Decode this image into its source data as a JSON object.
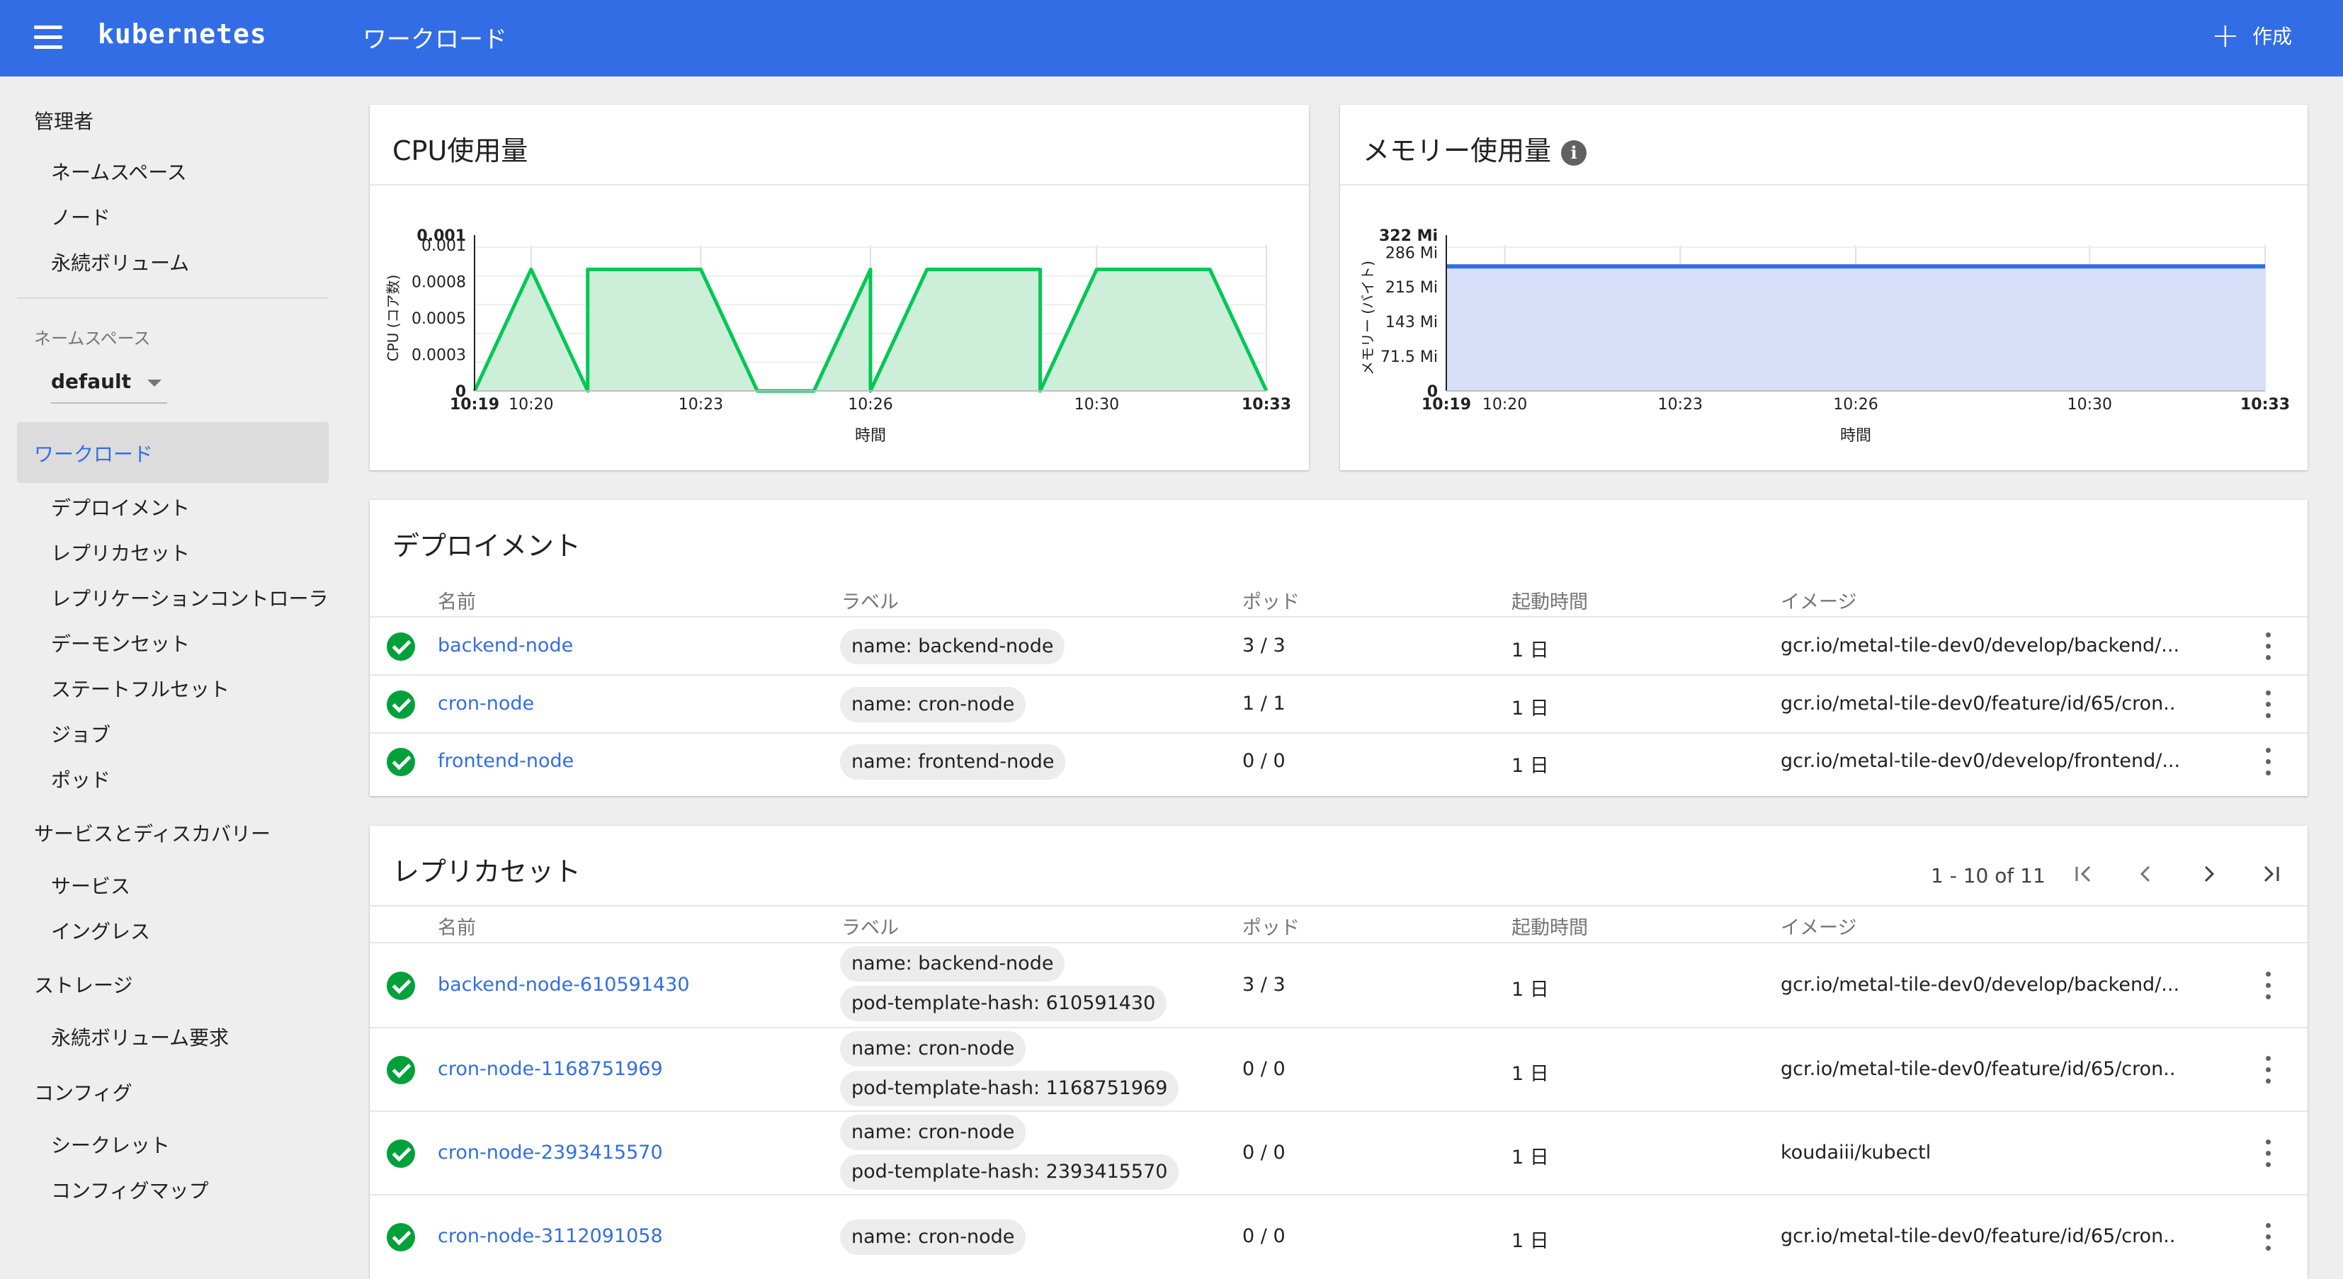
{
  "header": {
    "brand": "kubernetes",
    "title": "ワークロード",
    "create_label": "作成"
  },
  "sidebar": {
    "admin_title": "管理者",
    "admin_items": [
      "ネームスペース",
      "ノード",
      "永続ボリューム"
    ],
    "namespace_label": "ネームスペース",
    "namespace_value": "default",
    "workloads_label": "ワークロード",
    "workload_items": [
      "デプロイメント",
      "レプリカセット",
      "レプリケーションコントローラ",
      "デーモンセット",
      "ステートフルセット",
      "ジョブ",
      "ポッド"
    ],
    "discovery_title": "サービスとディスカバリー",
    "discovery_items": [
      "サービス",
      "イングレス"
    ],
    "storage_title": "ストレージ",
    "storage_items": [
      "永続ボリューム要求"
    ],
    "config_title": "コンフィグ",
    "config_items": [
      "シークレット",
      "コンフィグマップ"
    ]
  },
  "cpu_card": {
    "title": "CPU使用量"
  },
  "memory_card": {
    "title": "メモリー使用量"
  },
  "chart_data": [
    {
      "type": "area",
      "title": "CPU使用量",
      "xlabel": "時間",
      "ylabel": "CPU (コア数)",
      "y_ticks": [
        "0",
        "0.0003",
        "0.0005",
        "0.0008",
        "0.001",
        "0.001"
      ],
      "x_ticks": [
        "10:19",
        "10:20",
        "10:23",
        "10:26",
        "10:30",
        "10:33"
      ],
      "x": [
        "10:19",
        "10:20",
        "10:21",
        "10:21",
        "10:22",
        "10:23",
        "10:24",
        "10:24",
        "10:25",
        "10:26",
        "10:26",
        "10:27",
        "10:28",
        "10:29",
        "10:29",
        "10:30",
        "10:31",
        "10:32",
        "10:33"
      ],
      "values": [
        0,
        0.001,
        0,
        0.001,
        0.001,
        0.001,
        0,
        0,
        0,
        0.001,
        0,
        0.001,
        0.001,
        0.001,
        0,
        0.001,
        0.001,
        0.001,
        0
      ],
      "ylim": [
        0,
        0.0012
      ],
      "color": "#00c853",
      "fill": "#cdeed9",
      "grid": true
    },
    {
      "type": "area",
      "title": "メモリー使用量",
      "xlabel": "時間",
      "ylabel": "メモリー (バイト)",
      "y_ticks": [
        "0",
        "71.5 Mi",
        "143 Mi",
        "215 Mi",
        "286 Mi",
        "322 Mi"
      ],
      "x_ticks": [
        "10:19",
        "10:20",
        "10:23",
        "10:26",
        "10:30",
        "10:33"
      ],
      "x": [
        "10:19",
        "10:33"
      ],
      "values": [
        275,
        275
      ],
      "ylim": [
        0,
        322
      ],
      "color": "#326de6",
      "fill": "#d7e0f8",
      "grid": true
    }
  ],
  "deployments": {
    "title": "デプロイメント",
    "headers": [
      "名前",
      "ラベル",
      "ポッド",
      "起動時間",
      "イメージ"
    ],
    "rows": [
      {
        "name": "backend-node",
        "labels": [
          "name: backend-node"
        ],
        "pods": "3 / 3",
        "age": "1 日",
        "image": "gcr.io/metal-tile-dev0/develop/backend/..."
      },
      {
        "name": "cron-node",
        "labels": [
          "name: cron-node"
        ],
        "pods": "1 / 1",
        "age": "1 日",
        "image": "gcr.io/metal-tile-dev0/feature/id/65/cron.."
      },
      {
        "name": "frontend-node",
        "labels": [
          "name: frontend-node"
        ],
        "pods": "0 / 0",
        "age": "1 日",
        "image": "gcr.io/metal-tile-dev0/develop/frontend/..."
      }
    ]
  },
  "replicasets": {
    "title": "レプリカセット",
    "pagination": "1 - 10 of 11",
    "headers": [
      "名前",
      "ラベル",
      "ポッド",
      "起動時間",
      "イメージ"
    ],
    "rows": [
      {
        "name": "backend-node-610591430",
        "labels": [
          "name: backend-node",
          "pod-template-hash: 610591430"
        ],
        "pods": "3 / 3",
        "age": "1 日",
        "image": "gcr.io/metal-tile-dev0/develop/backend/..."
      },
      {
        "name": "cron-node-1168751969",
        "labels": [
          "name: cron-node",
          "pod-template-hash: 1168751969"
        ],
        "pods": "0 / 0",
        "age": "1 日",
        "image": "gcr.io/metal-tile-dev0/feature/id/65/cron.."
      },
      {
        "name": "cron-node-2393415570",
        "labels": [
          "name: cron-node",
          "pod-template-hash: 2393415570"
        ],
        "pods": "0 / 0",
        "age": "1 日",
        "image": "koudaiii/kubectl"
      },
      {
        "name": "cron-node-3112091058",
        "labels": [
          "name: cron-node"
        ],
        "pods": "0 / 0",
        "age": "1 日",
        "image": "gcr.io/metal-tile-dev0/feature/id/65/cron.."
      }
    ]
  }
}
